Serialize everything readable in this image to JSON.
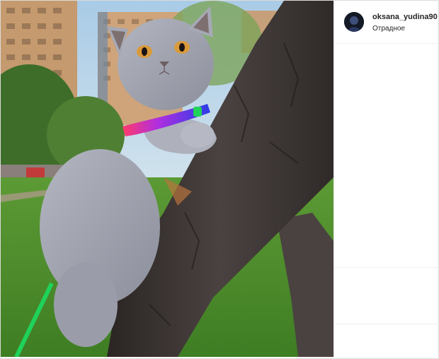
{
  "post": {
    "username": "oksana_yudina90",
    "location": "Отрадное"
  },
  "photo": {
    "subject": "grey british shorthair cat climbing a tree trunk on a harness"
  },
  "colors": {
    "sky": "#9cc1df",
    "grass": "#4f8f2c",
    "cat_fur": "#9ea1ad",
    "tree_bark": "#3b3431",
    "leash": "#1fd25a",
    "border": "#dbdbdb"
  }
}
